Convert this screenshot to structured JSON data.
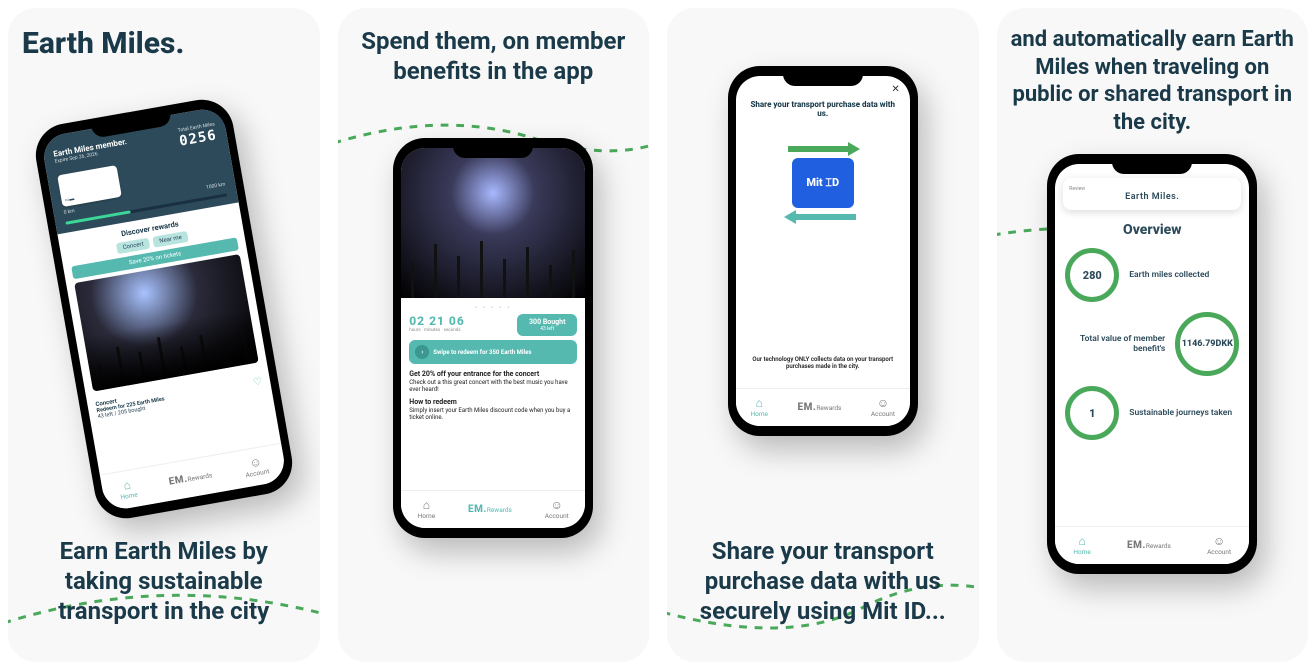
{
  "brand": "Earth Miles.",
  "panels": {
    "p1": {
      "marketing": "Earn Earth Miles by taking sustainable transport in the city",
      "phone": {
        "member_label": "Earth Miles member.",
        "expiry": "Expire Sep 26, 2026",
        "miles_label": "Total Earth Miles",
        "miles": "0256",
        "progress_right": "1000 km",
        "discover": "Discover rewards",
        "tag1": "Concert",
        "tag2": "Near me",
        "banner": "Save 20% on tickets",
        "meta_cat": "Concert",
        "meta_title": "Redeem for 225 Earth Miles",
        "meta_stock": "43 left / 205 bought"
      }
    },
    "p2": {
      "marketing": "Spend them, on member benefits in the app",
      "phone": {
        "timer": "02 21 06",
        "timer_labels": "hours · minutes · seconds",
        "bought": "300 Bought",
        "bought_sub": "43 left",
        "swipe": "Swipe to redeem for 350 Earth Miles",
        "offer_title": "Get 20% off your entrance for the concert",
        "offer_sub": "Check out a this great concert with the best music you have ever heard!",
        "howto_h": "How to redeem",
        "howto_b": "Simply insert your Earth Miles discount code when you buy a ticket online."
      }
    },
    "p3": {
      "marketing": "Share your transport purchase data with us securely using Mit ID...",
      "phone": {
        "title": "Share your transport purchase data with us.",
        "mitid": "Mit ⌶D",
        "footer": "Our technology ONLY collects data on your transport purchases made in the city."
      }
    },
    "p4": {
      "marketing": "and automatically earn Earth Miles when traveling on public or shared transport in the city.",
      "phone": {
        "review": "Review",
        "logo_text": "Earth Miles.",
        "overview": "Overview",
        "stat1_val": "280",
        "stat1_lbl": "Earth miles collected",
        "stat2_val": "1146.79DKK",
        "stat2_lbl": "Total value of member benefit's",
        "stat3_val": "1",
        "stat3_lbl": "Sustainable journeys taken"
      }
    }
  },
  "tabs": {
    "home": "Home",
    "rewards": "Rewards",
    "rewards_logo": "EM.",
    "account": "Account"
  }
}
